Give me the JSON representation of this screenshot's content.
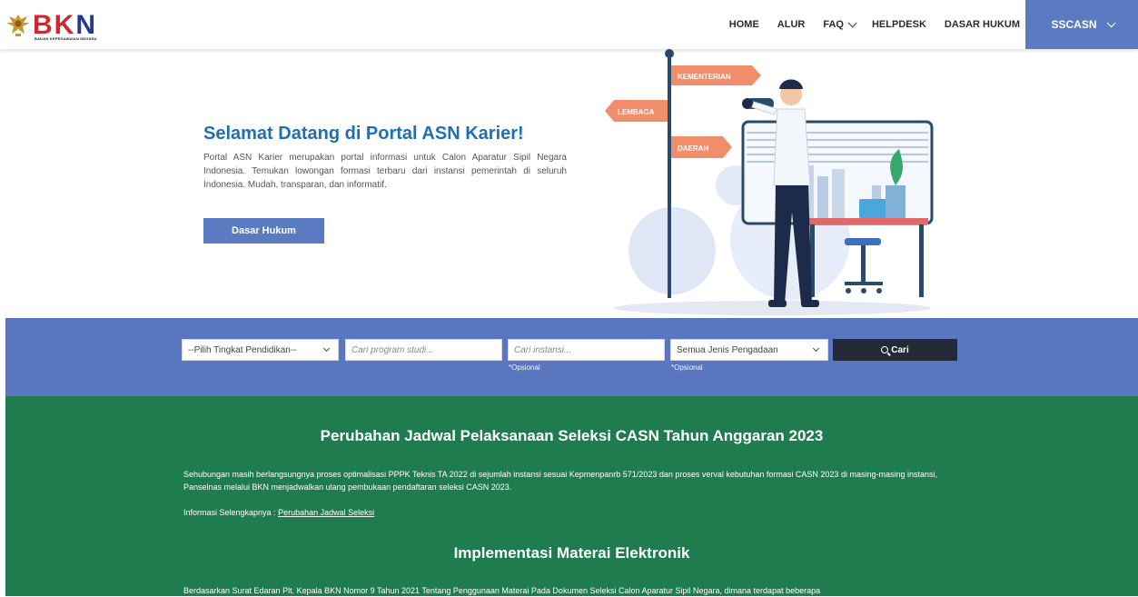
{
  "header": {
    "logo_text": "BKN",
    "logo_sub": "BADAN KEPEGAWAIAN NEGARA",
    "nav": [
      {
        "label": "HOME",
        "dropdown": false
      },
      {
        "label": "ALUR",
        "dropdown": false
      },
      {
        "label": "FAQ",
        "dropdown": true
      },
      {
        "label": "HELPDESK",
        "dropdown": false
      },
      {
        "label": "DASAR HUKUM",
        "dropdown": false
      }
    ],
    "account_label": "SSCASN"
  },
  "hero": {
    "title": "Selamat Datang di Portal ASN Karier!",
    "description": "Portal ASN Karier merupakan portal informasi untuk Calon Aparatur Sipil Negara Indonesia. Temukan lowongan formasi terbaru dari instansi pemerintah di seluruh Indonesia. Mudah, transparan, dan informatif.",
    "button_label": "Dasar Hukum",
    "signs": [
      "KEMENTERIAN",
      "LEMBAGA",
      "DAERAH"
    ]
  },
  "search": {
    "education_select": "--Pilih Tingkat Pendidikan--",
    "program_placeholder": "Cari program studi...",
    "instansi_placeholder": "Cari instansi...",
    "instansi_note": "*Opsional",
    "procurement_select": "Semua Jenis Pengadaan",
    "procurement_note": "*Opsional",
    "button_label": "Cari"
  },
  "info": {
    "heading1": "Perubahan Jadwal Pelaksanaan Seleksi CASN Tahun Anggaran 2023",
    "para1": "Sehubungan masih berlangsungnya proses optimalisasi PPPK Teknis TA 2022 di sejumlah instansi sesuai Kepmenpanrb 571/2023 dan proses verval kebutuhan formasi CASN 2023 di masing-masing instansi, Panselnas melalui BKN menjadwalkan ulang pembukaan pendaftaran seleksi CASN 2023.",
    "more_prefix": "Informasi Selengkapnya : ",
    "more_link": "Perubahan Jadwal Seleksi",
    "heading2": "Implementasi Materai Elektronik",
    "para2": "Berdasarkan Surat Edaran Plt. Kepala BKN Nomor 9 Tahun 2021 Tentang Penggunaan Materai Pada Dokumen Seleksi Calon Aparatur Sipil Negara, dimana terdapat beberapa"
  },
  "colors": {
    "primary": "#5a7ac1",
    "title_blue": "#1f6fb3",
    "green": "#1e7c4e",
    "sign_orange": "#f08d6a",
    "dark_button": "#232a36"
  }
}
